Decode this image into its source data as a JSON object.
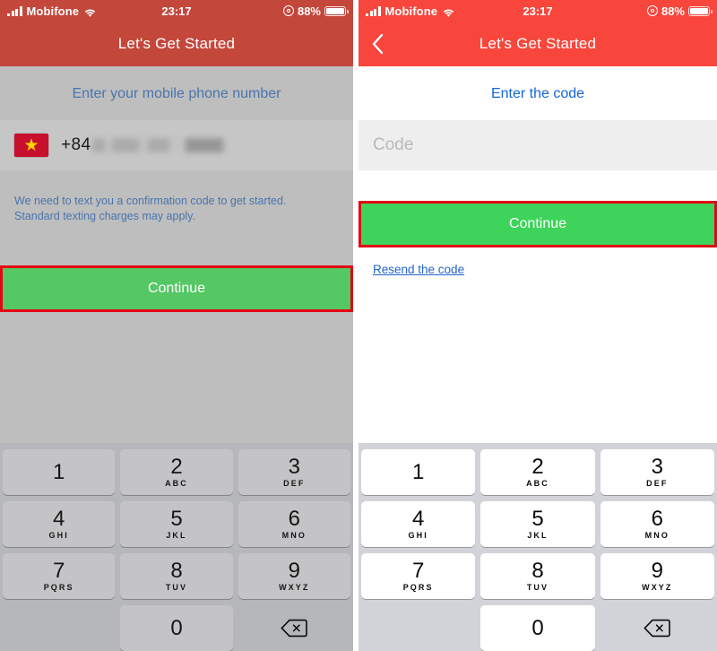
{
  "colors": {
    "brand_red": "#f8463c",
    "brand_red_dimmed": "#c4473c",
    "cta_green": "#3ed35a",
    "cta_green_dimmed": "#55c765",
    "link_blue": "#1565d8",
    "highlight_red": "#e30613",
    "keypad_bg_light": "#d1d3d9",
    "keypad_bg_dim": "#b6b7bb"
  },
  "status_bar": {
    "carrier": "Mobifone",
    "signal_icon": "signal-bars-icon",
    "wifi_icon": "wifi-icon",
    "time": "23:17",
    "alarm_icon": "alarm-clock-icon",
    "battery_percent": "88%",
    "battery_icon": "battery-icon"
  },
  "left_screen": {
    "nav": {
      "title": "Let's Get Started"
    },
    "heading": "Enter your mobile phone number",
    "phone_field": {
      "flag_icon": "vietnam-flag-icon",
      "country_code": "+84",
      "number_value": "",
      "number_state": "blurred"
    },
    "note_line1": "We need to text you a confirmation code to get started.",
    "note_line2": "Standard texting charges may apply.",
    "continue_label": "Continue",
    "continue_highlighted": true
  },
  "right_screen": {
    "nav": {
      "title": "Let's Get Started",
      "back_icon": "chevron-left-icon"
    },
    "heading": "Enter the code",
    "code_field": {
      "placeholder": "Code",
      "value": ""
    },
    "continue_label": "Continue",
    "continue_highlighted": true,
    "resend_label": "Resend the code"
  },
  "keypad": {
    "rows": [
      [
        {
          "digit": "1",
          "letters": ""
        },
        {
          "digit": "2",
          "letters": "ABC"
        },
        {
          "digit": "3",
          "letters": "DEF"
        }
      ],
      [
        {
          "digit": "4",
          "letters": "GHI"
        },
        {
          "digit": "5",
          "letters": "JKL"
        },
        {
          "digit": "6",
          "letters": "MNO"
        }
      ],
      [
        {
          "digit": "7",
          "letters": "PQRS"
        },
        {
          "digit": "8",
          "letters": "TUV"
        },
        {
          "digit": "9",
          "letters": "WXYZ"
        }
      ],
      [
        {
          "digit": "",
          "letters": "",
          "kind": "empty"
        },
        {
          "digit": "0",
          "letters": ""
        },
        {
          "digit": "",
          "letters": "",
          "kind": "delete",
          "icon": "backspace-delete-icon"
        }
      ]
    ]
  }
}
